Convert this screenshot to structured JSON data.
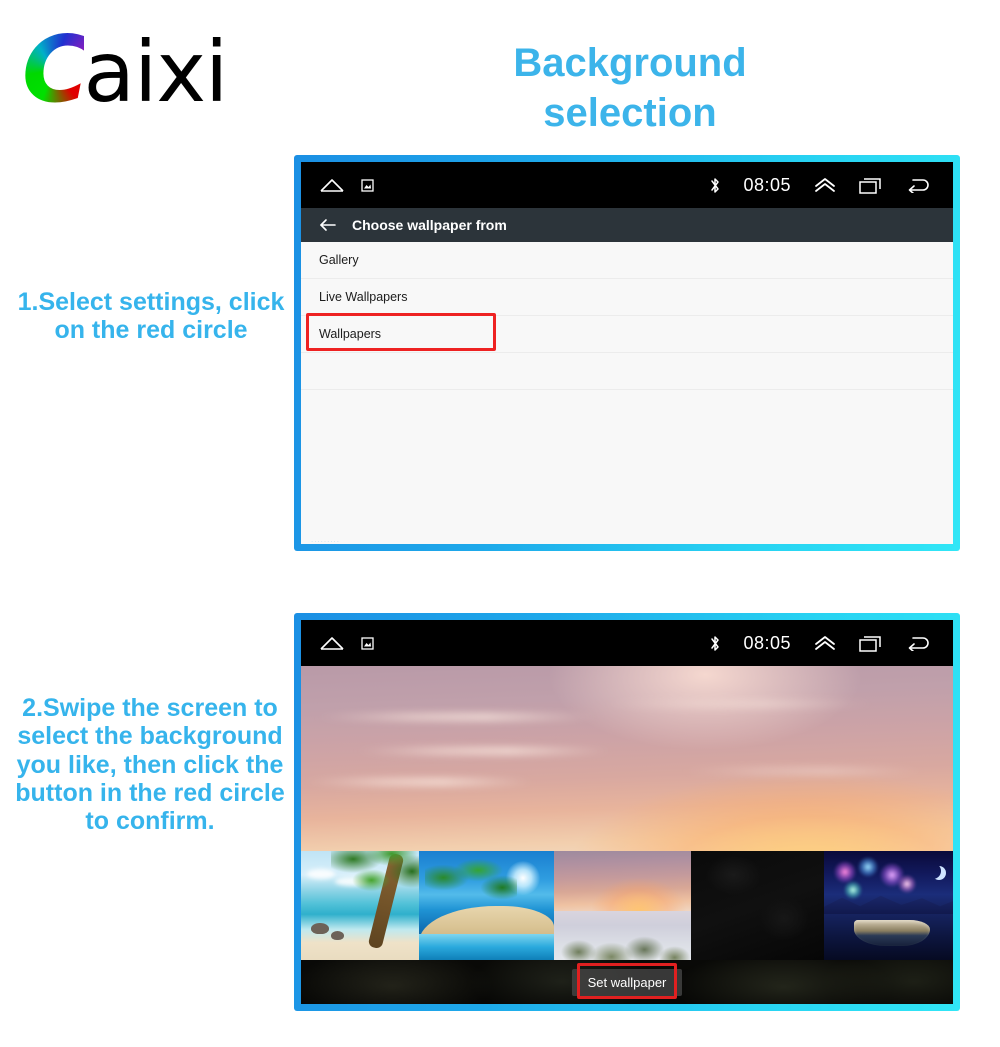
{
  "brand": {
    "logo_first": "C",
    "logo_rest": "aixi"
  },
  "page": {
    "title": "Background\nselection",
    "title_line1": "Background",
    "title_line2": "selection"
  },
  "steps": [
    {
      "id": "step-1",
      "text": "1.Select settings, click on the red circle"
    },
    {
      "id": "step-2",
      "text": "2.Swipe the screen to select the background you like, then click the button in the red circle to confirm."
    }
  ],
  "screen1": {
    "statusbar": {
      "home_icon": "home-icon",
      "sdcard_icon": "sdcard-icon",
      "bluetooth_icon": "bluetooth-icon",
      "time": "08:05",
      "chevron_up_icon": "chevron-up-icon",
      "recents_icon": "recents-icon",
      "back_icon": "back-icon"
    },
    "titlebar": {
      "back_icon": "arrow-left-icon",
      "title": "Choose wallpaper from"
    },
    "list": [
      {
        "label": "Gallery",
        "highlighted": false
      },
      {
        "label": "Live Wallpapers",
        "highlighted": false
      },
      {
        "label": "Wallpapers",
        "highlighted": true
      }
    ],
    "faint_bottom_text": "........."
  },
  "screen2": {
    "statusbar": {
      "home_icon": "home-icon",
      "sdcard_icon": "sdcard-icon",
      "bluetooth_icon": "bluetooth-icon",
      "time": "08:05",
      "chevron_up_icon": "chevron-up-icon",
      "recents_icon": "recents-icon",
      "back_icon": "back-icon"
    },
    "preview_name": "sunset-seascape-with-rocks",
    "thumbnails": [
      {
        "name": "tropical-beach-palm",
        "selected": false
      },
      {
        "name": "palm-island-blue-sea",
        "selected": false
      },
      {
        "name": "sunset-seascape-rocks",
        "selected": true
      },
      {
        "name": "dark-black-wallpaper",
        "selected": false
      },
      {
        "name": "night-fireworks-lake-boat",
        "selected": false
      }
    ],
    "set_wallpaper_label": "Set wallpaper",
    "set_wallpaper_highlighted": true
  },
  "colors": {
    "accent_blue": "#36b4ec",
    "frame_gradient_start": "#1b8fe4",
    "frame_gradient_end": "#31e6f6",
    "highlight_red": "#ee2222",
    "titlebar_bg": "#2c343a",
    "statusbar_bg": "#000000",
    "list_bg": "#f8f8f8"
  }
}
